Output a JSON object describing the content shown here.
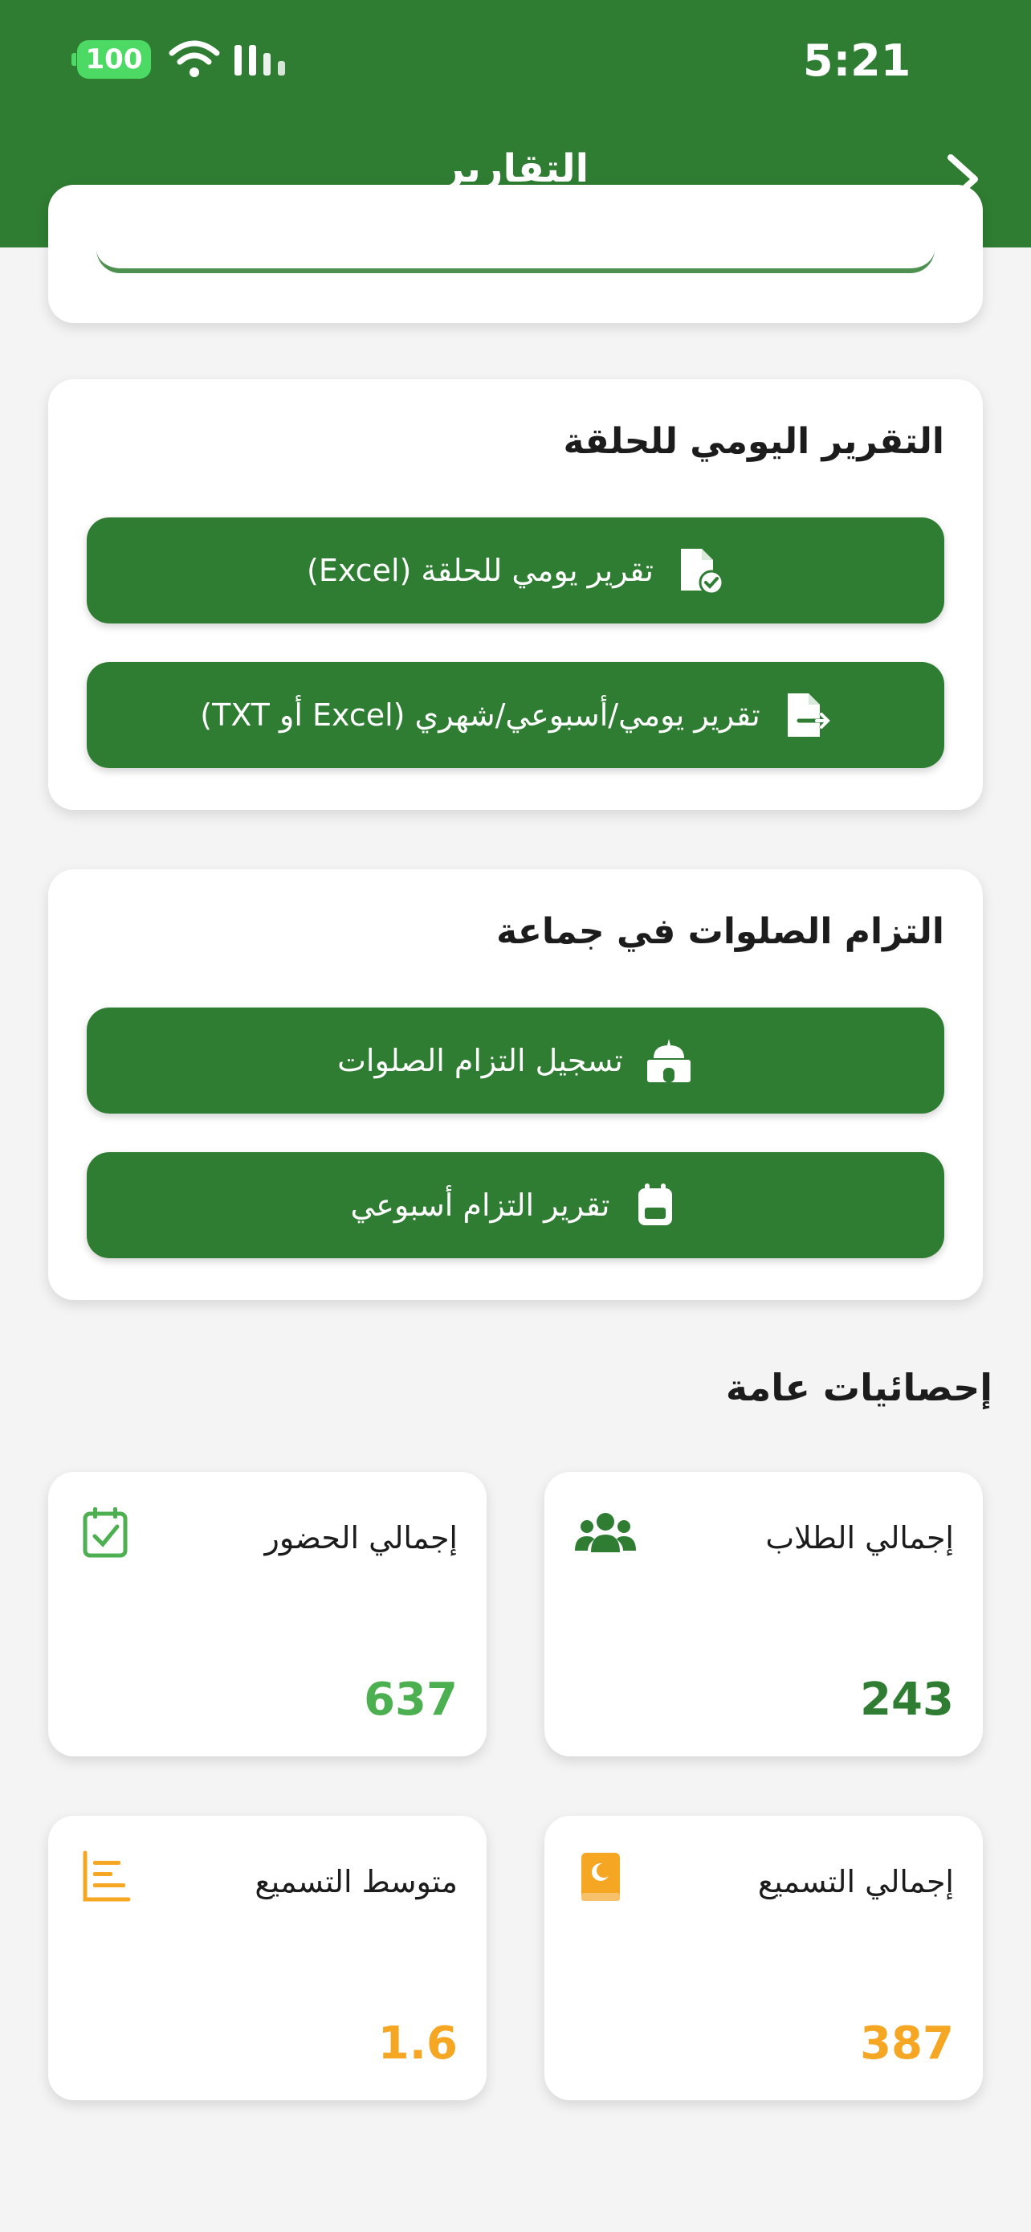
{
  "status_bar": {
    "time": "5:21",
    "battery": "100"
  },
  "header": {
    "title": "التقارير"
  },
  "daily_report": {
    "title": "التقرير اليومي للحلقة",
    "btn_daily_excel": "تقرير يومي للحلقة (Excel)",
    "btn_periodic": "تقرير يومي/أسبوعي/شهري (Excel أو TXT)"
  },
  "prayer": {
    "title": "التزام الصلوات في جماعة",
    "btn_record": "تسجيل التزام الصلوات",
    "btn_weekly": "تقرير التزام أسبوعي"
  },
  "stats": {
    "title": "إحصائيات عامة",
    "items": [
      {
        "label": "إجمالي الطلاب",
        "value": "243",
        "color": "#2e7d32",
        "icon": "users-icon"
      },
      {
        "label": "إجمالي الحضور",
        "value": "637",
        "color": "#4caf50",
        "icon": "calendar-check-icon"
      },
      {
        "label": "إجمالي التسميع",
        "value": "387",
        "color": "#f5a623",
        "icon": "quran-book-icon"
      },
      {
        "label": "متوسط التسميع",
        "value": "1.6",
        "color": "#f5a623",
        "icon": "bar-chart-icon"
      }
    ]
  }
}
